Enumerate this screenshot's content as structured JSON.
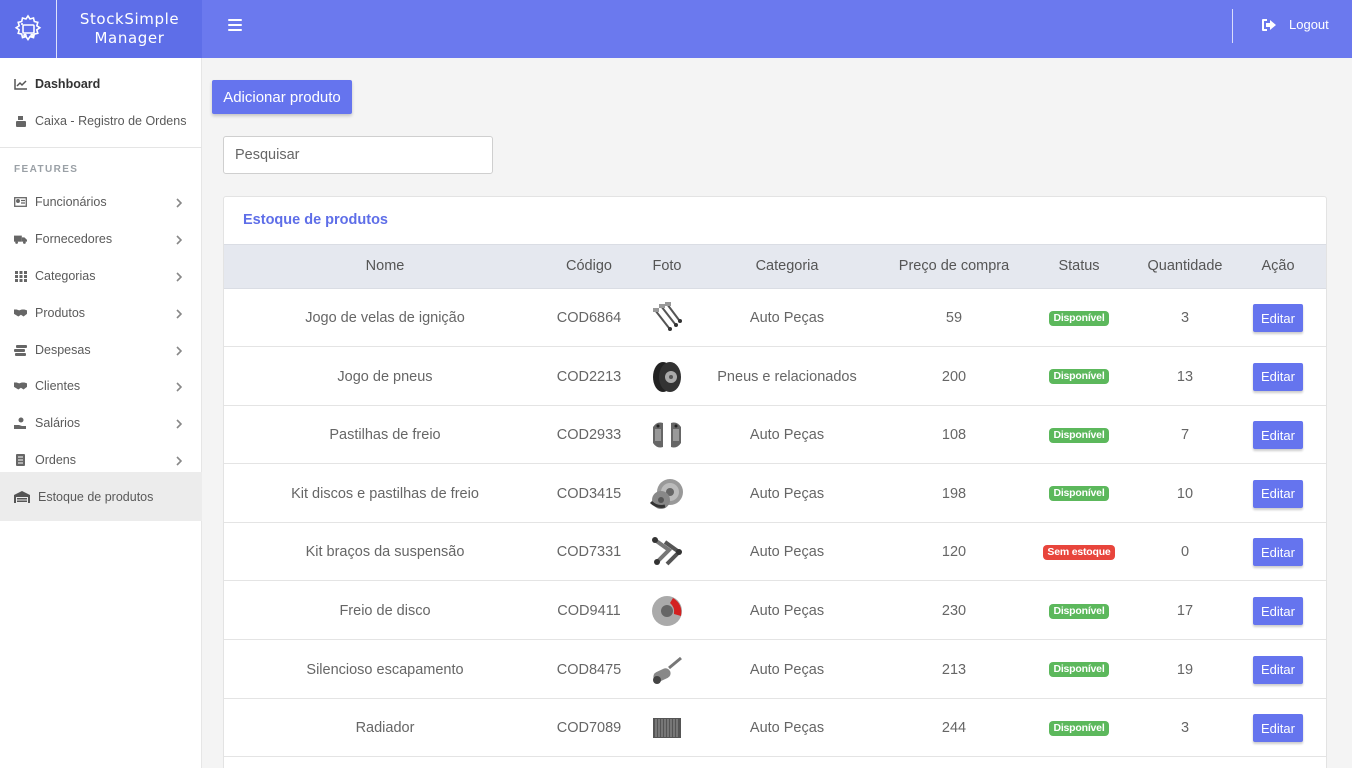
{
  "brand": {
    "line1": "StockSimple",
    "line2": "Manager",
    "logo_icon": "gear-cart-icon"
  },
  "topbar": {
    "menu_icon": "hamburger-icon",
    "logout_label": "Logout",
    "logout_icon": "sign-out-icon",
    "color": "#6b79ee"
  },
  "sidebar": {
    "dashboard": "Dashboard",
    "caixa": "Caixa - Registro de Ordens",
    "features_heading": "FEATURES",
    "items": [
      {
        "label": "Funcionários",
        "icon": "id-card-icon"
      },
      {
        "label": "Fornecedores",
        "icon": "truck-icon"
      },
      {
        "label": "Categorias",
        "icon": "grid-icon"
      },
      {
        "label": "Produtos",
        "icon": "handshake-icon"
      },
      {
        "label": "Despesas",
        "icon": "money-stack-icon"
      },
      {
        "label": "Clientes",
        "icon": "handshake-icon"
      },
      {
        "label": "Salários",
        "icon": "hand-coin-icon"
      },
      {
        "label": "Ordens",
        "icon": "document-icon"
      }
    ],
    "active": "Estoque de produtos"
  },
  "main": {
    "add_button": "Adicionar produto",
    "search_placeholder": "Pesquisar",
    "card_title": "Estoque de produtos",
    "columns": [
      "Nome",
      "Código",
      "Foto",
      "Categoria",
      "Preço de compra",
      "Status",
      "Quantidade",
      "Ação"
    ],
    "rows": [
      {
        "nome": "Jogo de velas de ignição",
        "codigo": "COD6864",
        "foto": "spark-plugs",
        "categoria": "Auto Peças",
        "preco": "59",
        "status": "Disponível",
        "quantidade": "3",
        "acao": "Editar"
      },
      {
        "nome": "Jogo de pneus",
        "codigo": "COD2213",
        "foto": "tires",
        "categoria": "Pneus e relacionados",
        "preco": "200",
        "status": "Disponível",
        "quantidade": "13",
        "acao": "Editar"
      },
      {
        "nome": "Pastilhas de freio",
        "codigo": "COD2933",
        "foto": "brake-pads",
        "categoria": "Auto Peças",
        "preco": "108",
        "status": "Disponível",
        "quantidade": "7",
        "acao": "Editar"
      },
      {
        "nome": "Kit discos e pastilhas de freio",
        "codigo": "COD3415",
        "foto": "brake-discs",
        "categoria": "Auto Peças",
        "preco": "198",
        "status": "Disponível",
        "quantidade": "10",
        "acao": "Editar"
      },
      {
        "nome": "Kit braços da suspensão",
        "codigo": "COD7331",
        "foto": "suspension-arms",
        "categoria": "Auto Peças",
        "preco": "120",
        "status": "Sem estoque",
        "quantidade": "0",
        "acao": "Editar"
      },
      {
        "nome": "Freio de disco",
        "codigo": "COD9411",
        "foto": "disc-brake",
        "categoria": "Auto Peças",
        "preco": "230",
        "status": "Disponível",
        "quantidade": "17",
        "acao": "Editar"
      },
      {
        "nome": "Silencioso escapamento",
        "codigo": "COD8475",
        "foto": "muffler",
        "categoria": "Auto Peças",
        "preco": "213",
        "status": "Disponível",
        "quantidade": "19",
        "acao": "Editar"
      },
      {
        "nome": "Radiador",
        "codigo": "COD7089",
        "foto": "radiator",
        "categoria": "Auto Peças",
        "preco": "244",
        "status": "Disponível",
        "quantidade": "3",
        "acao": "Editar"
      }
    ]
  },
  "colors": {
    "primary": "#6574ee",
    "success": "#5cb85c",
    "danger": "#e8453c"
  }
}
